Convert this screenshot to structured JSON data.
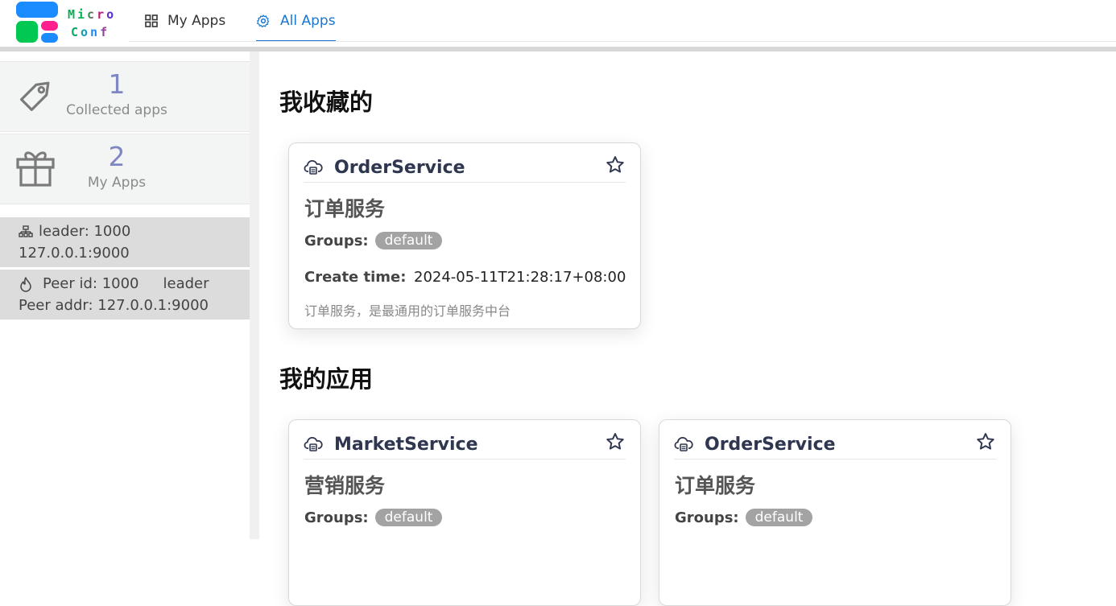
{
  "app": {
    "logo_line1": "Micro",
    "logo_line2": "Conf",
    "colors": {
      "accent": "#1677d2",
      "stat_number": "#7f86c4",
      "tag_bg": "#a3a3a3",
      "logo_blue": "#1a8cff",
      "logo_green": "#00c853",
      "logo_pink": "#ff1f8e"
    }
  },
  "nav": {
    "items": [
      {
        "label": "My Apps",
        "icon": "grid-icon",
        "active": false
      },
      {
        "label": "All Apps",
        "icon": "gear-icon",
        "active": true
      }
    ]
  },
  "sidebar": {
    "stats": [
      {
        "value": "1",
        "label": "Collected apps",
        "icon": "tag-icon"
      },
      {
        "value": "2",
        "label": "My Apps",
        "icon": "gift-icon"
      }
    ],
    "cluster": {
      "leader_text": "leader: 1000",
      "leader_addr": "127.0.0.1:9000",
      "peer_id": "Peer id: 1000",
      "peer_role": "leader",
      "peer_addr": "Peer addr: 127.0.0.1:9000"
    }
  },
  "main": {
    "favorites_title": "我收藏的",
    "my_apps_title": "我的应用",
    "favorites": [
      {
        "name": "OrderService",
        "cn_name": "订单服务",
        "groups_label": "Groups:",
        "group": "default",
        "create_label": "Create time:",
        "create_time": "2024-05-11T21:28:17+08:00",
        "description": "订单服务，是最通用的订单服务中台"
      }
    ],
    "apps": [
      {
        "name": "MarketService",
        "cn_name": "营销服务",
        "groups_label": "Groups:",
        "group": "default"
      },
      {
        "name": "OrderService",
        "cn_name": "订单服务",
        "groups_label": "Groups:",
        "group": "default"
      }
    ]
  }
}
